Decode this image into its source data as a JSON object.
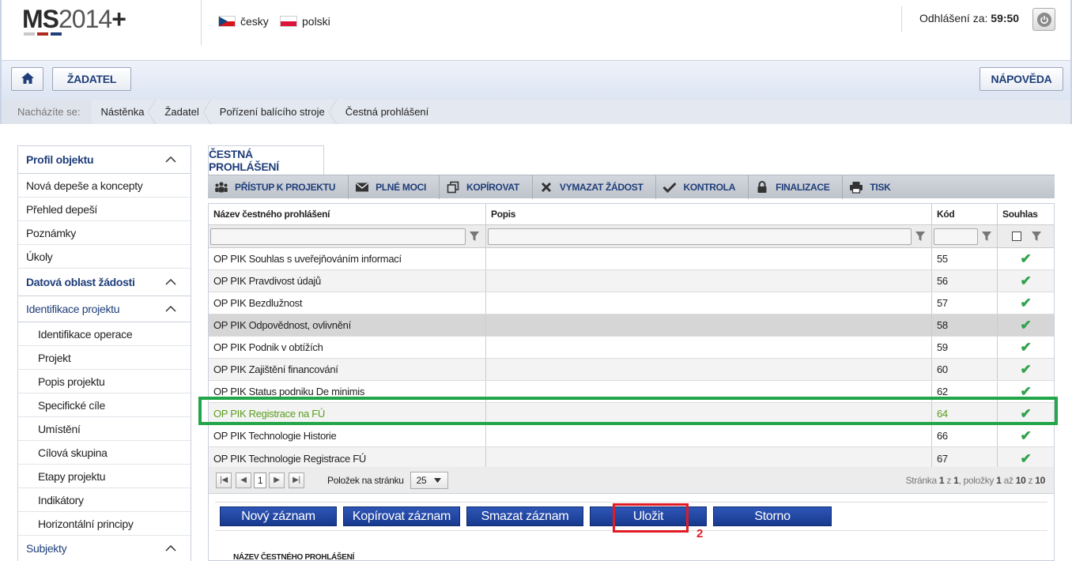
{
  "header": {
    "logo_ms": "MS",
    "logo_year": "2014",
    "logo_plus": "+",
    "logo_bar_colors": [
      "#c8c8c8",
      "#b02a1f",
      "#1f3e7a"
    ],
    "languages": [
      {
        "label": "česky",
        "flag": "czech-flag-icon"
      },
      {
        "label": "polski",
        "flag": "polish-flag-icon"
      }
    ],
    "logout_label": "Odhlášení za:",
    "logout_time": "59:50"
  },
  "topbar": {
    "home_icon": "home-icon",
    "zadatel_label": "ŽADATEL",
    "napoveda_label": "NÁPOVĚDA"
  },
  "breadcrumb": {
    "label": "Nacházíte se:",
    "items": [
      "Nástěnka",
      "Žadatel",
      "Pořízení balícího stroje",
      "Čestná prohlášení"
    ]
  },
  "sidenav": {
    "profil": "Profil objektu",
    "items": [
      "Nová depeše a koncepty",
      "Přehled depeší",
      "Poznámky",
      "Úkoly"
    ],
    "datova": "Datová oblast žádosti",
    "identifikace": "Identifikace projektu",
    "sub_items": [
      "Identifikace operace",
      "Projekt",
      "Popis projektu",
      "Specifické cíle",
      "Umístění",
      "Cílová skupina",
      "Etapy projektu",
      "Indikátory",
      "Horizontální principy"
    ],
    "subjekty": "Subjekty"
  },
  "main": {
    "tab_label": "ČESTNÁ PROHLÁŠENÍ",
    "actions": [
      {
        "label": "PŘÍSTUP K PROJEKTU",
        "icon": "people-icon"
      },
      {
        "label": "PLNÉ MOCI",
        "icon": "envelope-icon"
      },
      {
        "label": "KOPÍROVAT",
        "icon": "copy-icon"
      },
      {
        "label": "VYMAZAT ŽÁDOST",
        "icon": "delete-icon"
      },
      {
        "label": "KONTROLA",
        "icon": "check-icon"
      },
      {
        "label": "FINALIZACE",
        "icon": "lock-icon"
      },
      {
        "label": "TISK",
        "icon": "printer-icon"
      }
    ]
  },
  "grid": {
    "columns": [
      "Název čestného prohlášení",
      "Popis",
      "Kód",
      "Souhlas"
    ],
    "rows": [
      {
        "name": "OP PIK Souhlas s uveřejňováním informací",
        "popis": "",
        "kod": "55",
        "souhlas": "✔"
      },
      {
        "name": "OP PIK Pravdivost údajů",
        "popis": "",
        "kod": "56",
        "souhlas": "✔"
      },
      {
        "name": "OP PIK Bezdlužnost",
        "popis": "",
        "kod": "57",
        "souhlas": "✔"
      },
      {
        "name": "OP PIK Odpovědnost, ovlivnění",
        "popis": "",
        "kod": "58",
        "souhlas": "✔"
      },
      {
        "name": "OP PIK Podnik v obtížích",
        "popis": "",
        "kod": "59",
        "souhlas": "✔"
      },
      {
        "name": "OP PIK Zajištění financování",
        "popis": "",
        "kod": "60",
        "souhlas": "✔"
      },
      {
        "name": "OP PIK Status podniku De minimis",
        "popis": "",
        "kod": "62",
        "souhlas": "✔"
      },
      {
        "name": "OP PIK Registrace na FÚ",
        "popis": "",
        "kod": "64",
        "souhlas": "✔"
      },
      {
        "name": "OP PIK Technologie Historie",
        "popis": "",
        "kod": "66",
        "souhlas": "✔"
      },
      {
        "name": "OP PIK Technologie Registrace FÚ",
        "popis": "",
        "kod": "67",
        "souhlas": "✔"
      }
    ]
  },
  "pager": {
    "current_page": "1",
    "per_page_label": "Položek na stránku",
    "per_page_value": "25",
    "info_prefix": "Stránka",
    "page": "1",
    "z": "z",
    "pages": "1",
    "items_label": ", položky",
    "from": "1",
    "az": "až",
    "to": "10",
    "z2": "z",
    "total": "10"
  },
  "form_buttons": {
    "novy": "Nový záznam",
    "kopirovat": "Kopírovat záznam",
    "smazat": "Smazat záznam",
    "ulozit": "Uložit",
    "storno": "Storno"
  },
  "detail_label": "NÁZEV ČESTNÉHO PROHLÁŠENÍ",
  "annotation_number": "2",
  "colors": {
    "accent": "#1f3e7a",
    "button": "#1f48a8",
    "highlight_row": "#23a64a",
    "highlight_button": "#e01b24",
    "check": "#2fa24b"
  }
}
